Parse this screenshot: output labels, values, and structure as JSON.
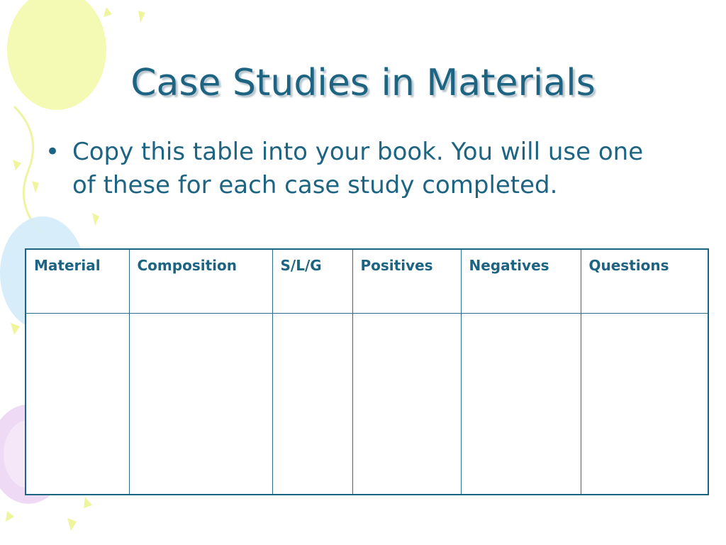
{
  "slide": {
    "title": "Case Studies in Materials",
    "bullets": [
      "Copy this table into your book. You will use one of these for each case study completed."
    ],
    "bullet_glyph": "•"
  },
  "table": {
    "columns": [
      "Material",
      "Composition",
      "S/L/G",
      "Positives",
      "Negatives",
      "Questions"
    ],
    "rows": [
      [
        "",
        "",
        "",
        "",
        "",
        ""
      ]
    ]
  },
  "colors": {
    "text": "#1d6483",
    "border": "#1d6483",
    "balloon_yellow": "#f2f8a6",
    "balloon_blue": "#d3ecfa",
    "balloon_purple": "#ecd6f3",
    "background": "#ffffff"
  },
  "decor": {
    "items": [
      "yellow-balloon",
      "blue-balloon",
      "purple-balloon",
      "confetti"
    ]
  }
}
